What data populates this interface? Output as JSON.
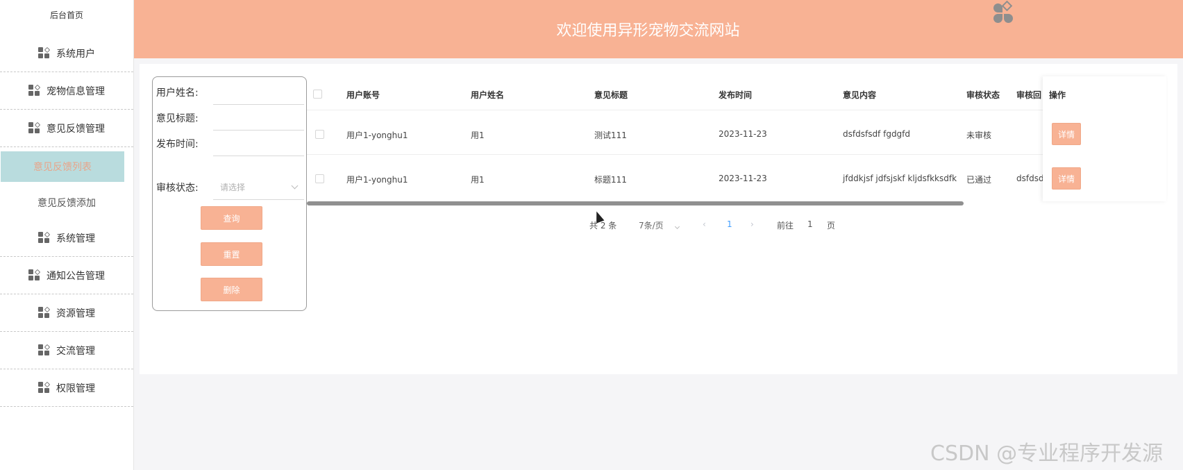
{
  "sidebar": {
    "home": "后台首页",
    "items": [
      {
        "label": "系统用户"
      },
      {
        "label": "宠物信息管理"
      },
      {
        "label": "意见反馈管理"
      },
      {
        "label": "系统管理"
      },
      {
        "label": "通知公告管理"
      },
      {
        "label": "资源管理"
      },
      {
        "label": "交流管理"
      },
      {
        "label": "权限管理"
      }
    ],
    "subitems": [
      {
        "label": "意见反馈列表",
        "active": true
      },
      {
        "label": "意见反馈添加",
        "active": false
      }
    ]
  },
  "header": {
    "title": "欢迎使用异形宠物交流网站"
  },
  "search": {
    "fields": [
      {
        "label": "用户姓名:",
        "value": ""
      },
      {
        "label": "意见标题:",
        "value": ""
      },
      {
        "label": "发布时间:",
        "value": ""
      }
    ],
    "status_label": "审核状态:",
    "status_placeholder": "请选择",
    "buttons": {
      "query": "查询",
      "reset": "重置",
      "delete": "删除"
    }
  },
  "table": {
    "columns": [
      "用户账号",
      "用户姓名",
      "意见标题",
      "发布时间",
      "意见内容",
      "审核状态",
      "审核回",
      "操作"
    ],
    "rows": [
      {
        "account": "用户1-yonghu1",
        "name": "用1",
        "title": "测试111",
        "time": "2023-11-23",
        "content": "dsfdsfsdf fgdgfd",
        "status": "未审核",
        "reply": "",
        "action": "详情"
      },
      {
        "account": "用户1-yonghu1",
        "name": "用1",
        "title": "标题111",
        "time": "2023-11-23",
        "content": "jfddkjsf jdfsjskf kljdsfkksdfk",
        "status": "已通过",
        "reply": "dsfdsd",
        "action": "详情"
      }
    ]
  },
  "pagination": {
    "total": "共 2 条",
    "page_size": "7条/页",
    "current_page": "1",
    "goto_prefix": "前往",
    "goto_value": "1",
    "goto_suffix": "页"
  },
  "watermark": "CSDN @专业程序开发源",
  "colors": {
    "accent": "#f8b294",
    "active_bg": "#b9dcde",
    "active_text": "#e8a58a",
    "page_link": "#409eff"
  }
}
